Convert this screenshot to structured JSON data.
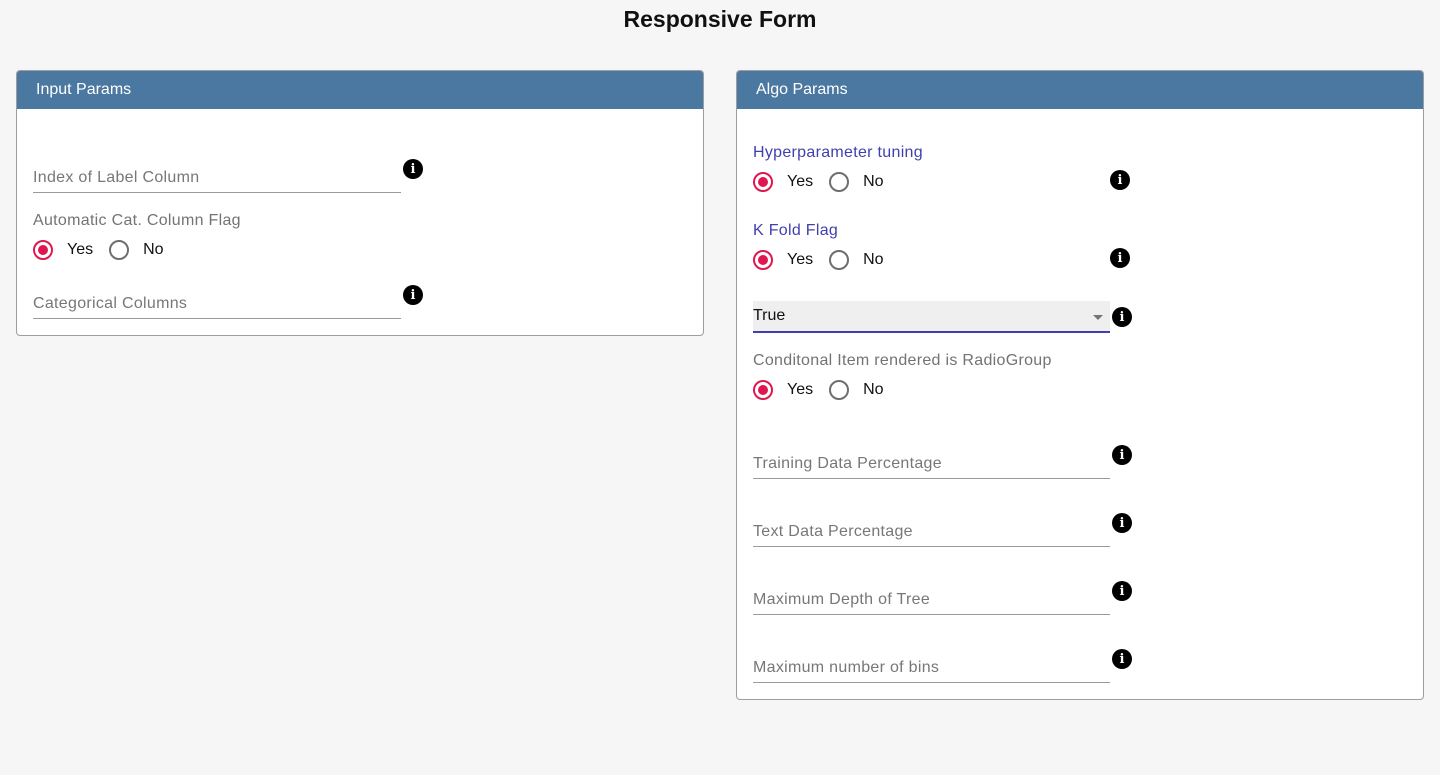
{
  "page": {
    "title": "Responsive Form"
  },
  "input_params": {
    "header": "Input Params",
    "label_column_placeholder": "Index of Label Column",
    "auto_cat_flag": {
      "label": "Automatic Cat. Column Flag",
      "options": [
        "Yes",
        "No"
      ],
      "selected": "Yes"
    },
    "categorical_columns_placeholder": "Categorical Columns"
  },
  "algo_params": {
    "header": "Algo Params",
    "hyperparameter": {
      "label": "Hyperparameter tuning",
      "options": [
        "Yes",
        "No"
      ],
      "selected": "Yes"
    },
    "kfold": {
      "label": "K Fold Flag",
      "options": [
        "Yes",
        "No"
      ],
      "selected": "Yes"
    },
    "select": {
      "value": "True"
    },
    "conditional": {
      "label": "Conditonal Item rendered is RadioGroup",
      "options": [
        "Yes",
        "No"
      ],
      "selected": "Yes"
    },
    "training_placeholder": "Training Data Percentage",
    "text_placeholder": "Text Data Percentage",
    "max_depth_placeholder": "Maximum Depth of Tree",
    "max_bins_placeholder": "Maximum number of bins"
  },
  "icons": {
    "info": "info-icon",
    "info_glyph": "i"
  },
  "colors": {
    "header_bg": "#4b78a1",
    "radio_checked": "#e0174f",
    "focus_blue": "#3f3fb0"
  }
}
